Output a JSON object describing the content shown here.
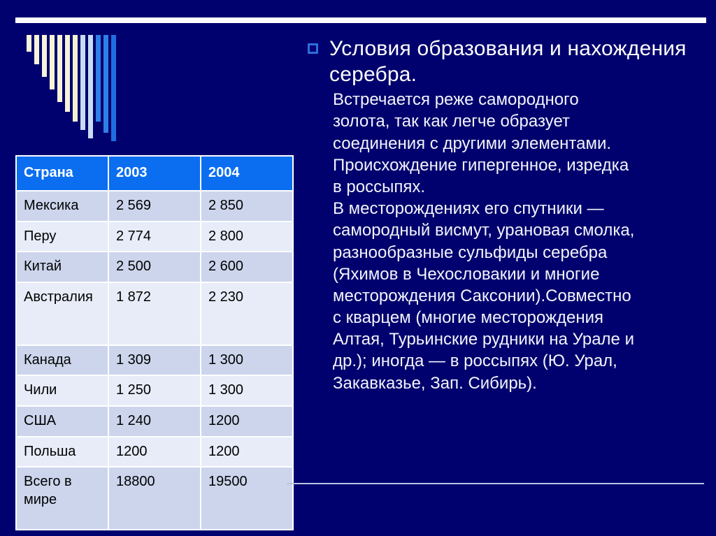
{
  "slide": {
    "background_color": "#00006e",
    "top_rule_color": "#ffffff",
    "bottom_rule_color": "#b8c2e0"
  },
  "decoration": {
    "name": "descending-bars-graphic",
    "bar_count": 12,
    "colors": [
      "#f7f3d8",
      "#f7f3d8",
      "#f7f3d8",
      "#f7f3d8",
      "#f7f3d8",
      "#f7f3d8",
      "#f5f0cf",
      "#c8dcf2",
      "#c8dcf2",
      "#2f7fe8",
      "#2f7fe8",
      "#1f6fe0"
    ],
    "heights": [
      24,
      42,
      60,
      78,
      96,
      110,
      124,
      136,
      148,
      124,
      140,
      152
    ]
  },
  "content": {
    "bullet_icon": "square-bullet-icon",
    "title": "Условия образования и нахождения серебра.",
    "paragraph1": "Встречается реже самородного\nзолота, так как легче образует\nсоединения с другими элементами.\nПроисхождение гипергенное, изредка\nв россыпях.",
    "paragraph2": "В месторождениях его спутники —\nсамородный висмут, урановая смолка,\nразнообразные сульфиды серебра\n(Яхимов в Чехословакии и многие\nместорождения Саксонии).Совместно\nс кварцем (многие месторождения\nАлтая, Турьинские рудники на Урале и\nдр.); иногда — в россыпях (Ю. Урал,\nЗакавказье, Зап. Сибирь)."
  },
  "table": {
    "header_bg": "#0b6ef0",
    "columns": [
      "Страна",
      "2003",
      "2004"
    ],
    "rows": [
      {
        "country": "Мексика",
        "y2003": "2 569",
        "y2004": "2 850",
        "tall": false
      },
      {
        "country": "Перу",
        "y2003": "2 774",
        "y2004": "2 800",
        "tall": false
      },
      {
        "country": "Китай",
        "y2003": "2 500",
        "y2004": "2 600",
        "tall": false
      },
      {
        "country": "Австралия",
        "y2003": "1 872",
        "y2004": "2 230",
        "tall": true
      },
      {
        "country": "Канада",
        "y2003": "1 309",
        "y2004": "1 300",
        "tall": false
      },
      {
        "country": "Чили",
        "y2003": "1 250",
        "y2004": "1 300",
        "tall": false
      },
      {
        "country": "США",
        "y2003": "1 240",
        "y2004": "1200",
        "tall": false
      },
      {
        "country": "Польша",
        "y2003": "1200",
        "y2004": "1200",
        "tall": false
      },
      {
        "country": "Всего в мире",
        "y2003": "18800",
        "y2004": "19500",
        "tall": true
      }
    ]
  }
}
